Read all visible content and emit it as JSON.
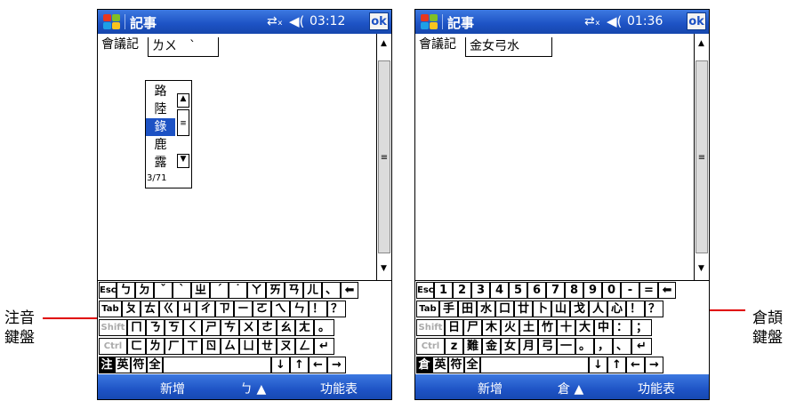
{
  "callouts": {
    "left": {
      "line1": "注音",
      "line2": "鍵盤"
    },
    "right": {
      "line1": "倉頡",
      "line2": "鍵盤"
    }
  },
  "screens": [
    {
      "app_title": "記事",
      "clock": "03:12",
      "ok_label": "ok",
      "note_text": "會議記",
      "composition": "ㄌㄨ　ˋ",
      "candidates": [
        "路",
        "陸",
        "錄",
        "鹿",
        "露"
      ],
      "selected_candidate_index": 2,
      "candidate_page": "3/71",
      "menu_left": "新增",
      "input_mode": "ㄅ ▲",
      "menu_right": "功能表",
      "keyboard": {
        "rows": [
          [
            "Esc",
            "ㄅ",
            "ㄉ",
            "ˇ",
            "ˋ",
            "ㄓ",
            "ˊ",
            "˙",
            "ㄚ",
            "ㄞ",
            "ㄢ",
            "ㄦ",
            "、",
            "⬅"
          ],
          [
            "Tab",
            "ㄆ",
            "ㄊ",
            "ㄍ",
            "ㄐ",
            "ㄔ",
            "ㄗ",
            "ㄧ",
            "ㄛ",
            "ㄟ",
            "ㄣ",
            "！",
            "？"
          ],
          [
            "Shift",
            "ㄇ",
            "ㄋ",
            "ㄎ",
            "ㄑ",
            "ㄕ",
            "ㄘ",
            "ㄨ",
            "ㄜ",
            "ㄠ",
            "ㄤ",
            "。"
          ],
          [
            "Ctrl",
            "ㄈ",
            "ㄌ",
            "ㄏ",
            "ㄒ",
            "ㄖ",
            "ㄙ",
            "ㄩ",
            "ㄝ",
            "ㄡ",
            "ㄥ",
            "↵"
          ],
          [
            "注",
            "英",
            "符",
            "全",
            "",
            "↓",
            "↑",
            "←",
            "→"
          ]
        ]
      }
    },
    {
      "app_title": "記事",
      "clock": "01:36",
      "ok_label": "ok",
      "note_text": "會議記",
      "composition": "金女弓水",
      "menu_left": "新增",
      "input_mode": "倉 ▲",
      "menu_right": "功能表",
      "keyboard": {
        "rows": [
          [
            "Esc",
            "1",
            "2",
            "3",
            "4",
            "5",
            "6",
            "7",
            "8",
            "9",
            "0",
            "-",
            "=",
            "⬅"
          ],
          [
            "Tab",
            "手",
            "田",
            "水",
            "口",
            "廿",
            "卜",
            "山",
            "戈",
            "人",
            "心",
            "！",
            "？"
          ],
          [
            "Shift",
            "日",
            "尸",
            "木",
            "火",
            "土",
            "竹",
            "十",
            "大",
            "中",
            "：",
            "；"
          ],
          [
            "Ctrl",
            "z",
            "難",
            "金",
            "女",
            "月",
            "弓",
            "一",
            "。",
            "，",
            "、",
            "↵"
          ],
          [
            "倉",
            "英",
            "符",
            "全",
            "",
            "↓",
            "↑",
            "←",
            "→"
          ]
        ]
      }
    }
  ]
}
